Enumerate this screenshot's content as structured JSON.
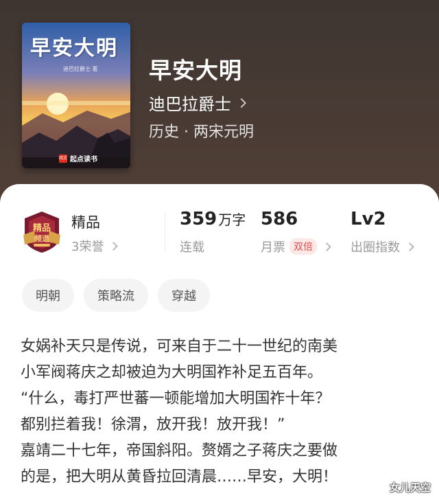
{
  "book": {
    "cover_title": "早安大明",
    "cover_author": "迪巴拉爵士 著",
    "cover_publisher": "起点读书",
    "cover_publisher_logo": "阅文",
    "title": "早安大明",
    "author": "迪巴拉爵士",
    "category": "历史 · 两宋元明"
  },
  "stats": {
    "quality": "精品",
    "honors": "3荣誉",
    "word_count": "359",
    "word_unit": "万字",
    "status": "连载",
    "monthly_tickets": "586",
    "monthly_tickets_label": "月票",
    "double_badge": "双倍",
    "level": "Lv2",
    "level_label": "出圈指数"
  },
  "tags": [
    "明朝",
    "策略流",
    "穿越"
  ],
  "synopsis": [
    "女娲补天只是传说，可来自于二十一世纪的南美",
    "小军阀蒋庆之却被迫为大明国祚补足五百年。",
    "“什么，毒打严世蕃一顿能增加大明国祚十年？",
    "都别拦着我！徐渭，放开我！放开我！”",
    "嘉靖二十七年，帝国斜阳。赘婿之子蒋庆之要做",
    "的是，把大明从黄昏拉回清晨……早安，大明！"
  ],
  "watermark": "女儿天空",
  "colors": {
    "header_bg": "#4a3b33",
    "accent_red": "#e04a4a",
    "tag_bg": "#f4f4f4"
  },
  "icons": [
    "chevron-right-icon",
    "quality-badge-icon"
  ]
}
